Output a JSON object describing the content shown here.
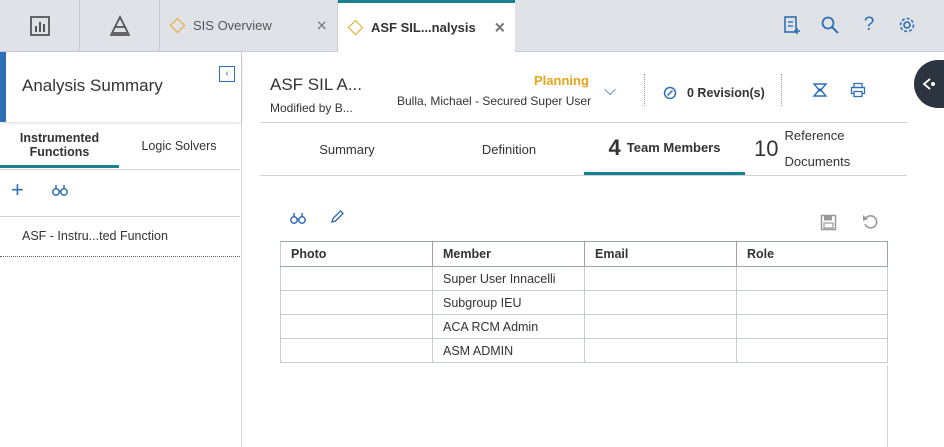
{
  "top_tabs": [
    {
      "label": "SIS Overview",
      "active": false
    },
    {
      "label": "ASF SIL...nalysis",
      "active": true
    }
  ],
  "left_panel": {
    "title": "Analysis Summary",
    "tabs": [
      {
        "label": "Instrumented Functions",
        "active": true
      },
      {
        "label": "Logic Solvers",
        "active": false
      }
    ],
    "items": [
      "ASF - Instru...ted Function"
    ]
  },
  "header": {
    "record_title": "ASF SIL A...",
    "modified_by": "Modified by B...",
    "state": "Planning",
    "assigned_user": "Bulla, Michael - Secured Super User",
    "revisions": "0 Revision(s)"
  },
  "main_tabs": [
    {
      "count": "",
      "label": "Summary",
      "active": false
    },
    {
      "count": "",
      "label": "Definition",
      "active": false
    },
    {
      "count": "4",
      "label": "Team Members",
      "active": true
    },
    {
      "count": "10",
      "label": "Reference Documents",
      "active": false
    }
  ],
  "table": {
    "columns": [
      "Photo",
      "Member",
      "Email",
      "Role"
    ],
    "rows": [
      [
        "",
        "Super User Innacelli",
        "",
        ""
      ],
      [
        "",
        "Subgroup IEU",
        "",
        ""
      ],
      [
        "",
        "ACA RCM Admin",
        "",
        ""
      ],
      [
        "",
        "ASM ADMIN",
        "",
        ""
      ]
    ]
  },
  "colors": {
    "accent": "#1a7f8e",
    "brand_blue": "#2f6fb5",
    "state_orange": "#e8a317"
  }
}
